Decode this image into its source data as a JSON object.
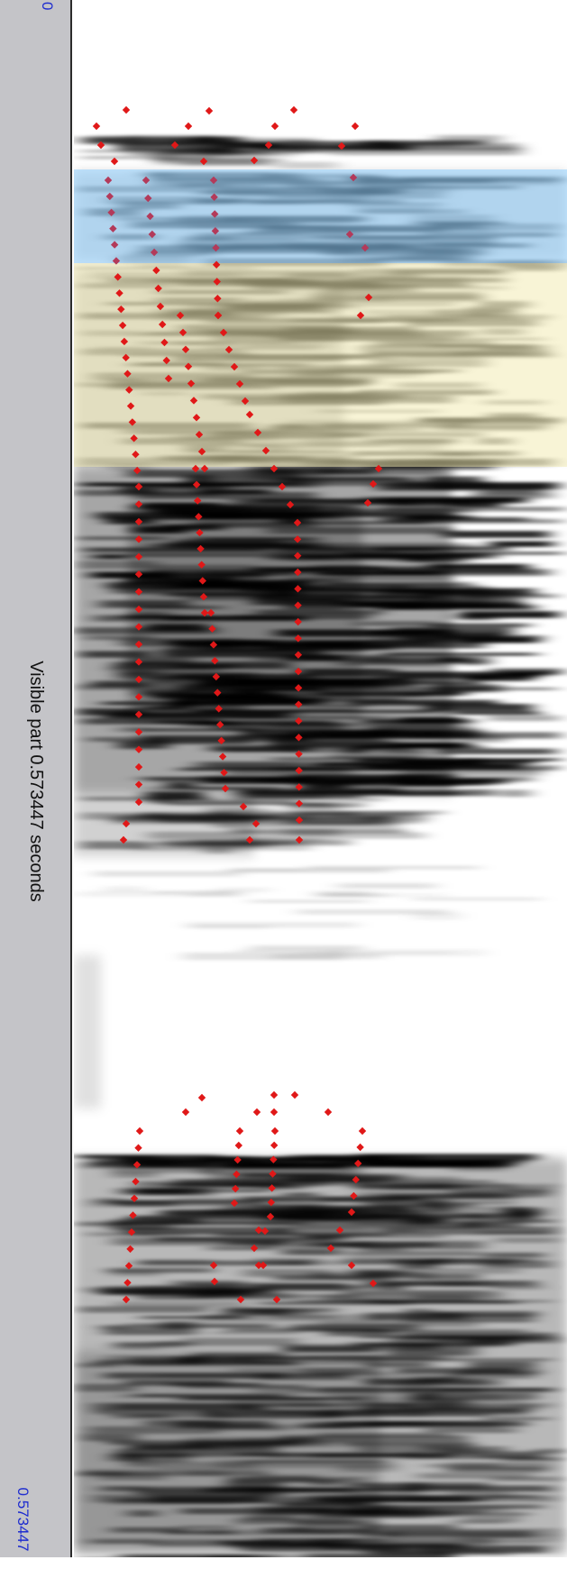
{
  "time_axis": {
    "start_label": "0",
    "visible_part_label": "Visible part 0.573447 seconds",
    "end_label": "0.573447"
  },
  "selection": {
    "blue_color": "#8fd0ff",
    "yellow_color": "#f2eab0"
  },
  "overlay": {
    "point_color": "#e01818",
    "point_color_in_blue": "#b33a5a"
  },
  "spectrogram": {
    "background": "#ffffff",
    "ink": "#000000"
  }
}
